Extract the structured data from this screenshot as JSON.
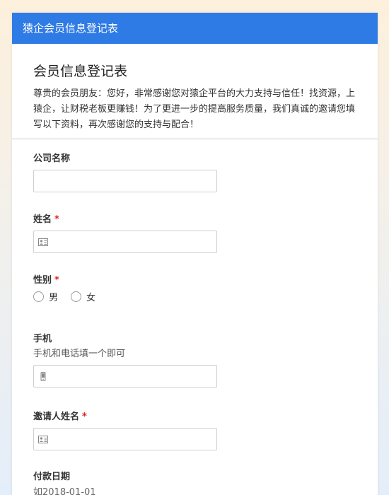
{
  "header": {
    "title": "猿企会员信息登记表"
  },
  "intro": {
    "title": "会员信息登记表",
    "description": "尊贵的会员朋友：您好，非常感谢您对猿企平台的大力支持与信任！找资源，上猿企，让财税老板更赚钱！为了更进一步的提高服务质量，我们真诚的邀请您填写以下资料，再次感谢您的支持与配合！"
  },
  "fields": {
    "company": {
      "label": "公司名称",
      "value": ""
    },
    "name": {
      "label": "姓名",
      "required_mark": "*",
      "value": "",
      "icon": "contact-card-icon"
    },
    "gender": {
      "label": "性别",
      "required_mark": "*",
      "options": [
        "男",
        "女"
      ]
    },
    "phone": {
      "label": "手机",
      "hint": "手机和电话填一个即可",
      "value": "",
      "icon": "mobile-phone-icon"
    },
    "inviter": {
      "label": "邀请人姓名",
      "required_mark": "*",
      "value": "",
      "icon": "contact-card-icon"
    },
    "pay_date": {
      "label": "付款日期",
      "placeholder": "如2018-01-01"
    }
  },
  "colors": {
    "header_bg": "#2f7be5",
    "required": "#e02020"
  }
}
